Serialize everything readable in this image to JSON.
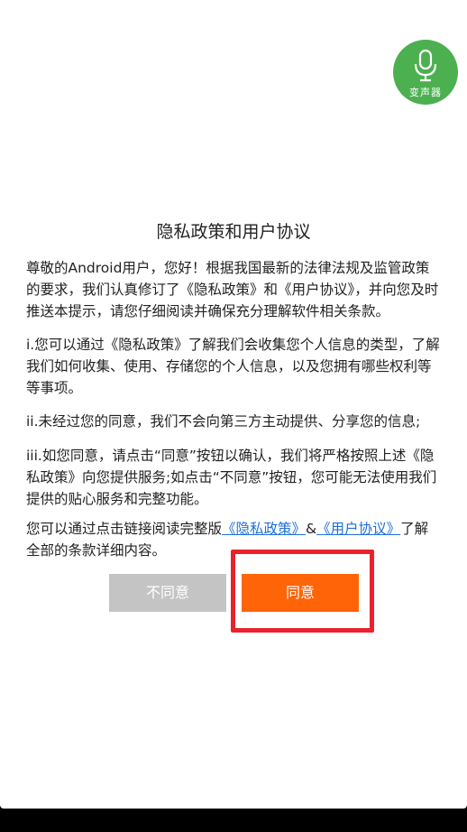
{
  "logo": {
    "icon": "microphone-icon",
    "text": "变声器",
    "color": "#4caf50"
  },
  "dialog": {
    "title": "隐私政策和用户协议",
    "paragraphs": {
      "intro": "尊敬的Android用户，您好！根据我国最新的法律法规及监管政策的要求，我们认真修订了《隐私政策》和《用户协议》，并向您及时推送本提示，请您仔细阅读并确保充分理解软件相关条款。",
      "item_i": "i.您可以通过《隐私政策》了解我们会收集您个人信息的类型，了解我们如何收集、使用、存储您的个人信息，以及您拥有哪些权利等等事项。",
      "item_ii": "ii.未经过您的同意，我们不会向第三方主动提供、分享您的信息;",
      "item_iii": "iii.如您同意，请点击“同意”按钮以确认，我们将严格按照上述《隐私政策》向您提供服务;如点击“不同意”按钮，您可能无法使用我们提供的贴心服务和完整功能。",
      "footer_prefix": "您可以通过点击链接阅读完整版",
      "privacy_link": "《隐私政策》",
      "link_separator": "&",
      "agreement_link": "《用户协议》",
      "footer_suffix": "了解全部的条款详细内容。"
    },
    "buttons": {
      "disagree": "不同意",
      "agree": "同意"
    }
  },
  "colors": {
    "agree_button": "#ff6508",
    "disagree_button": "#c4c4c4",
    "link": "#1e6fd9",
    "highlight_border": "#e8232d"
  }
}
